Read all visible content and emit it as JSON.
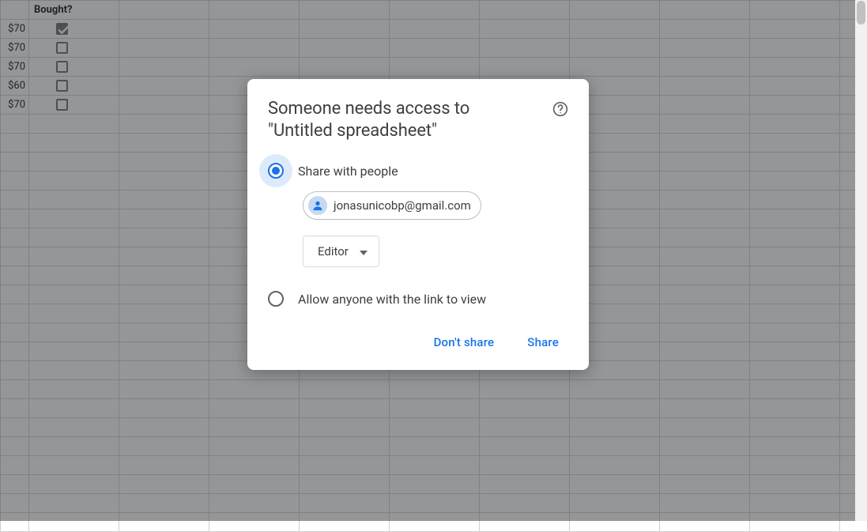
{
  "sheet": {
    "header": "Bought?",
    "rows": [
      {
        "price": "$70",
        "bought": true
      },
      {
        "price": "$70",
        "bought": false
      },
      {
        "price": "$70",
        "bought": false
      },
      {
        "price": "$60",
        "bought": false
      },
      {
        "price": "$70",
        "bought": false
      }
    ]
  },
  "dialog": {
    "title": "Someone needs access to \"Untitled spreadsheet\"",
    "help_icon": "help-icon",
    "option_share_label": "Share with people",
    "chip_email": "jonasunicobp@gmail.com",
    "role": "Editor",
    "option_link_label": "Allow anyone with the link to view",
    "dont_share": "Don't share",
    "share": "Share"
  }
}
